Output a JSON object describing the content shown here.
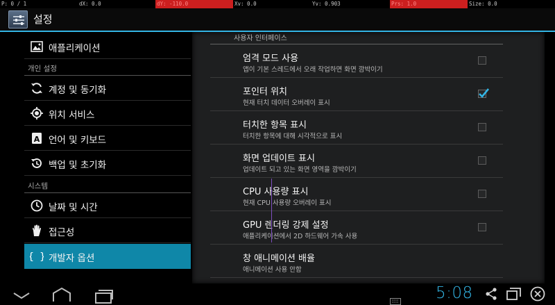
{
  "pointer_bar": {
    "p": "P: 0 / 1",
    "dx": "dX: 0.0",
    "dy": "dY: -110.0",
    "xv": "Xv: 0.0",
    "yv": "Yv: 0.903",
    "prs": "Prs: 1.0",
    "size": "Size: 0.0"
  },
  "app": {
    "title": "설정"
  },
  "headers": {
    "items": [
      {
        "label": "애플리케이션",
        "icon": "apps-icon"
      },
      {
        "label": "계정 및 동기화",
        "icon": "sync-icon"
      },
      {
        "label": "위치 서비스",
        "icon": "location-icon"
      },
      {
        "label": "언어 및 키보드",
        "icon": "language-icon"
      },
      {
        "label": "백업 및 초기화",
        "icon": "backup-icon"
      },
      {
        "label": "날짜 및 시간",
        "icon": "clock-icon"
      },
      {
        "label": "접근성",
        "icon": "hand-icon"
      },
      {
        "label": "개발자 옵션",
        "icon": "braces-icon",
        "active": true
      }
    ],
    "categories": [
      "개인 설정",
      "시스템"
    ]
  },
  "detail": {
    "section_title": "사용자 인터페이스",
    "prefs": [
      {
        "title": "엄격 모드 사용",
        "summary": "앱이 기본 스레드에서 오래 작업하면 화면 깜박이기",
        "checked": false
      },
      {
        "title": "포인터 위치",
        "summary": "현재 터치 데이터 오버레이 표시",
        "checked": true
      },
      {
        "title": "터치한 항목 표시",
        "summary": "터치한 항목에 대해 시각적으로 표시",
        "checked": false
      },
      {
        "title": "화면 업데이트 표시",
        "summary": "업데이트 되고 있는 화면 영역을 깜박이기",
        "checked": false
      },
      {
        "title": "CPU 사용량 표시",
        "summary": "현재 CPU 사용량 오버레이 표시",
        "checked": false
      },
      {
        "title": "GPU 렌더링 강제 설정",
        "summary": "애플리케이션에서 2D 하드웨어 가속 사용",
        "checked": false
      },
      {
        "title": "창 애니메이션 배율",
        "summary": "애니메이션 사용 안함",
        "checked": null
      }
    ]
  },
  "status": {
    "clock": "5:08"
  },
  "colors": {
    "accent": "#33b5e5",
    "active_item": "#0f87a8",
    "pointer_red": "#cc1f1f"
  }
}
